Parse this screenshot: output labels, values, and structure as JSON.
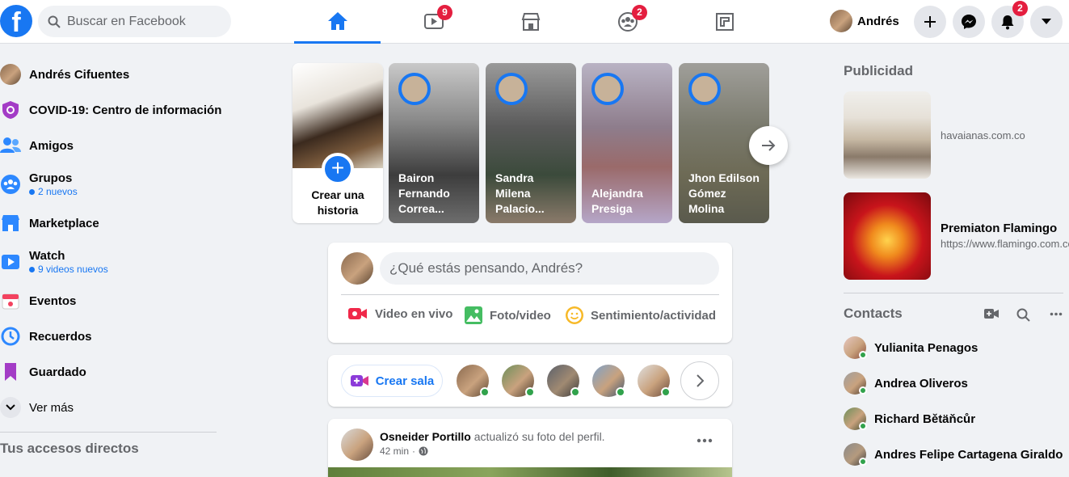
{
  "header": {
    "logo_letter": "f",
    "search_placeholder": "Buscar en Facebook",
    "tabs": [
      {
        "name": "home",
        "badge": ""
      },
      {
        "name": "watch",
        "badge": "9"
      },
      {
        "name": "marketplace",
        "badge": ""
      },
      {
        "name": "groups",
        "badge": "2"
      },
      {
        "name": "gaming",
        "badge": ""
      }
    ],
    "profile_name": "Andrés",
    "notifications_badge": "2",
    "accent": "#1877f2"
  },
  "sidebar": {
    "items": [
      {
        "label": "Andrés Cifuentes",
        "sub": "",
        "icon": "avatar"
      },
      {
        "label": "COVID-19: Centro de información",
        "sub": "",
        "icon": "covid-shield-icon"
      },
      {
        "label": "Amigos",
        "sub": "",
        "icon": "friends-icon"
      },
      {
        "label": "Grupos",
        "sub": "2 nuevos",
        "icon": "groups-icon"
      },
      {
        "label": "Marketplace",
        "sub": "",
        "icon": "marketplace-icon"
      },
      {
        "label": "Watch",
        "sub": "9 videos nuevos",
        "icon": "watch-icon"
      },
      {
        "label": "Eventos",
        "sub": "",
        "icon": "events-icon"
      },
      {
        "label": "Recuerdos",
        "sub": "",
        "icon": "memories-icon"
      },
      {
        "label": "Guardado",
        "sub": "",
        "icon": "saved-icon"
      },
      {
        "label": "Ver más",
        "sub": "",
        "icon": "chevron-down-icon"
      }
    ],
    "shortcuts_title": "Tus accesos directos"
  },
  "stories": {
    "create_label": "Crear una historia",
    "items": [
      {
        "name": "Bairon Fernando Correa..."
      },
      {
        "name": "Sandra Milena Palacio..."
      },
      {
        "name": "Alejandra Presiga"
      },
      {
        "name": "Jhon Edilson Gómez Molina"
      }
    ]
  },
  "composer": {
    "placeholder": "¿Qué estás pensando, Andrés?",
    "actions": [
      {
        "label": "Video en vivo",
        "color": "#f02849"
      },
      {
        "label": "Foto/video",
        "color": "#45bd62"
      },
      {
        "label": "Sentimiento/actividad",
        "color": "#f7b928"
      }
    ]
  },
  "rooms": {
    "create_label": "Crear sala"
  },
  "post": {
    "author": "Osneider Portillo",
    "action": "actualizó su foto del perfil.",
    "time": "42 min"
  },
  "ads": {
    "title": "Publicidad",
    "items": [
      {
        "title": "",
        "url": "havaianas.com.co"
      },
      {
        "title": "Premiaton Flamingo",
        "url": "https://www.flamingo.com.co/"
      }
    ]
  },
  "contacts": {
    "title": "Contacts",
    "items": [
      {
        "name": "Yulianita Penagos"
      },
      {
        "name": "Andrea Oliveros"
      },
      {
        "name": "Richard Bětäňcůr"
      },
      {
        "name": "Andres Felipe Cartagena Giraldo"
      }
    ]
  }
}
